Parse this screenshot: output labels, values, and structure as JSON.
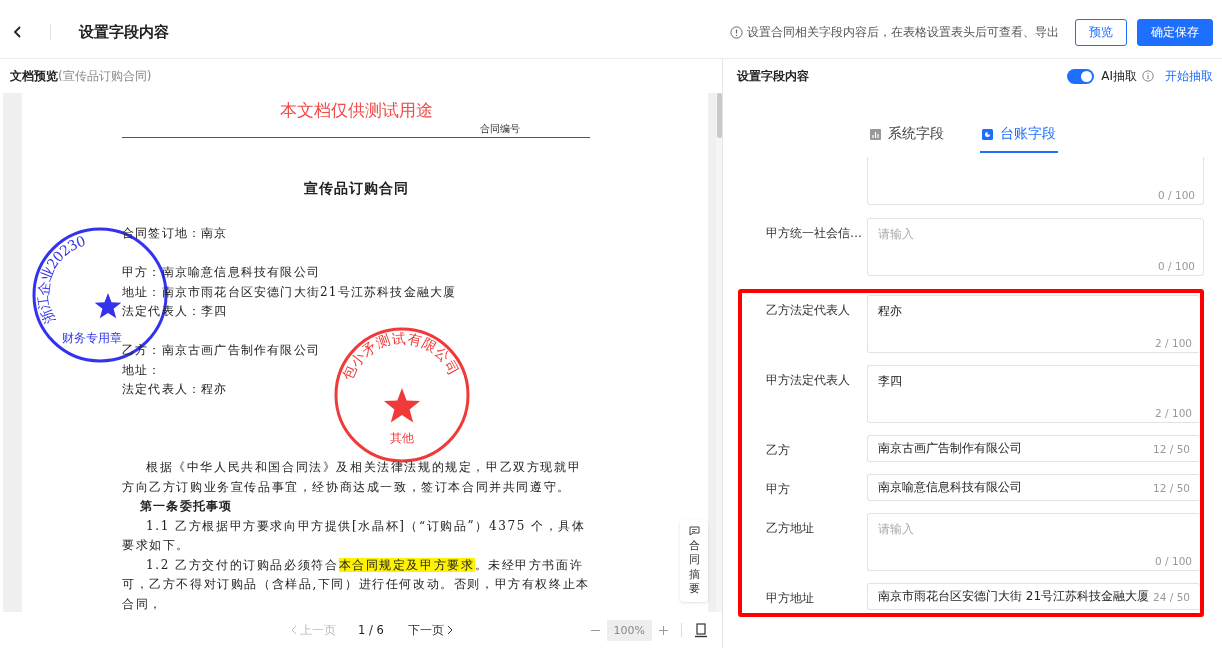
{
  "header": {
    "title": "设置字段内容",
    "hint": "设置合同相关字段内容后，在表格设置表头后可查看、导出",
    "buttons": [
      {
        "label": "预览",
        "kind": "secondary"
      },
      {
        "label": "确定保存",
        "kind": "primary"
      }
    ]
  },
  "preview": {
    "title": "文档预览",
    "subtitle": "(宣传品订购合同)",
    "document": {
      "watermark": "本文档仅供测试用途",
      "number_label": "合同编号",
      "title": "宣传品订购合同",
      "blocks": [
        {
          "kind": "line",
          "text": "合同签订地：南京"
        },
        {
          "kind": "gap"
        },
        {
          "kind": "line",
          "text": "甲方：南京喻意信息科技有限公司"
        },
        {
          "kind": "line",
          "text": "地址：南京市雨花台区安德门大街21号江苏科技金融大厦"
        },
        {
          "kind": "line",
          "text": "法定代表人：李四"
        },
        {
          "kind": "gap"
        },
        {
          "kind": "line",
          "text": "乙方：南京古画广告制作有限公司"
        },
        {
          "kind": "line",
          "text": "地址："
        },
        {
          "kind": "line",
          "text": "法定代表人：程亦"
        },
        {
          "kind": "gap"
        },
        {
          "kind": "gap"
        },
        {
          "kind": "gap"
        },
        {
          "kind": "para",
          "segments": [
            {
              "text": "根据《中华人民共和国合同法》及相关法律法规的规定，甲乙双方现就甲方向乙方订购业务宣传品事宜，经协商达成一致，签订本合同并共同遵守。",
              "highlighted": false
            }
          ]
        },
        {
          "kind": "heading",
          "text": "第一条委托事项"
        },
        {
          "kind": "para",
          "segments": [
            {
              "text": "1.1 乙方根据甲方要求向甲方提供[水晶杯]（“订购品”）4375 个，具体要求如下。",
              "highlighted": false
            }
          ]
        },
        {
          "kind": "para",
          "segments": [
            {
              "text": "1.2 乙方交付的订购品必须符合",
              "highlighted": false
            },
            {
              "text": "本合同规定及甲方要求",
              "highlighted": true
            },
            {
              "text": "。未经甲方书面许可，乙方不得对订购品（含样品,下同）进行任何改动。否则，甲方有权终止本合同，",
              "highlighted": false
            }
          ]
        }
      ]
    },
    "stamps": [
      {
        "arc_text": "浙江企业20230",
        "center_text": "财务专用章",
        "color": "#3333ee"
      },
      {
        "arc_text": "包小矛测试有限公司",
        "center_text": "其他",
        "color": "#f03a3a"
      }
    ],
    "summary_button": "合同摘要",
    "pager": {
      "prev": "上一页",
      "prev_disabled": true,
      "page": "1 / 6",
      "next": "下一页",
      "zoom": "100%"
    }
  },
  "fields_panel": {
    "title": "设置字段内容",
    "ai_toggle": {
      "label": "AI抽取",
      "on": true
    },
    "action": "开始抽取",
    "tabs": [
      {
        "label": "系统字段",
        "selected": false,
        "kind": "chart"
      },
      {
        "label": "台账字段",
        "selected": true,
        "kind": "pie"
      }
    ],
    "fields": [
      {
        "kind": "textarea_tail",
        "counter": "0 / 100",
        "highlighted": false
      },
      {
        "kind": "textarea",
        "label": "甲方统一社会信…",
        "placeholder": "请输入",
        "counter": "0 / 100",
        "highlighted": false
      },
      {
        "kind": "textarea",
        "label": "乙方法定代表人",
        "value": "程亦",
        "counter": "2 / 100",
        "highlighted": true
      },
      {
        "kind": "textarea",
        "label": "甲方法定代表人",
        "value": "李四",
        "counter": "2 / 100",
        "highlighted": true
      },
      {
        "kind": "input",
        "label": "乙方",
        "value": "南京古画广告制作有限公司",
        "counter": "12 / 50",
        "highlighted": true
      },
      {
        "kind": "input",
        "label": "甲方",
        "value": "南京喻意信息科技有限公司",
        "counter": "12 / 50",
        "highlighted": true
      },
      {
        "kind": "textarea",
        "label": "乙方地址",
        "placeholder": "请输入",
        "counter": "0 / 100",
        "highlighted": true
      },
      {
        "kind": "input",
        "label": "甲方地址",
        "value": "南京市雨花台区安德门大街 21号江苏科技金融大厦",
        "counter": "24 / 50",
        "highlighted": true
      }
    ]
  }
}
